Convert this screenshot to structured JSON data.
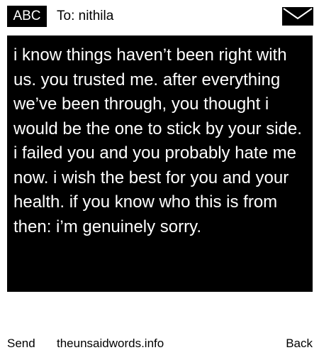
{
  "header": {
    "input_mode": "ABC",
    "recipient_label": "To: nithila",
    "envelope_icon": "envelope-icon"
  },
  "message": {
    "body": "i know things haven’t been right with us. you trusted me. after everything we’ve been through, you thought i would be the one to stick by your side. i failed you and you probably hate me now. i wish the best for you and your health. if you know who this is from then: i’m genuinely sorry."
  },
  "softkeys": {
    "left": "Send",
    "center": "theunsaidwords.info",
    "right": "Back"
  },
  "colors": {
    "background": "#ffffff",
    "message_background": "#000000",
    "message_text": "#ffffff",
    "text": "#000000"
  }
}
